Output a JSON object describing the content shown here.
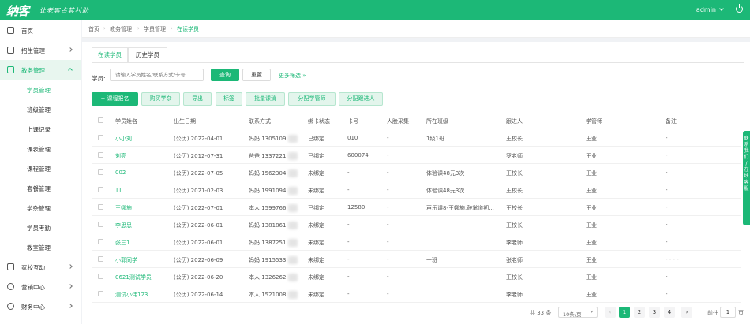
{
  "header": {
    "logo": "纳客",
    "slogan": "让老客占其村助",
    "user": "admin"
  },
  "colors": {
    "primary": "#1cb877"
  },
  "sidebar": {
    "items": [
      {
        "label": "首页",
        "icon": "home-icon"
      },
      {
        "label": "招生管理",
        "icon": "recruit-icon"
      },
      {
        "label": "教务管理",
        "icon": "book-icon"
      },
      {
        "label": "家校互动",
        "icon": "chat-icon"
      },
      {
        "label": "营销中心",
        "icon": "target-icon"
      },
      {
        "label": "财务中心",
        "icon": "money-icon"
      }
    ],
    "subitems": [
      "学员管理",
      "班级管理",
      "上课记录",
      "课表管理",
      "课程管理",
      "套餐管理",
      "学杂管理",
      "学员考勤",
      "教室管理"
    ]
  },
  "breadcrumb": [
    "首页",
    "教务管理",
    "学员管理",
    "在读学员"
  ],
  "tabs": [
    "在读学员",
    "历史学员"
  ],
  "filter": {
    "label": "学员:",
    "placeholder": "请输入学员姓名/联系方式/卡号",
    "search_btn": "查询",
    "reset_btn": "重置",
    "more": "更多筛选 »"
  },
  "actions": [
    "+ 课程报名",
    "购买学杂",
    "导出",
    "标签",
    "批量课消",
    "分配学管师",
    "分配跟进人"
  ],
  "table": {
    "headers": [
      "学员姓名",
      "出生日期",
      "联系方式",
      "绑卡状态",
      "卡号",
      "人脸采集",
      "所在班级",
      "跟进人",
      "学管师",
      "备注"
    ],
    "rows": [
      [
        "小小刘",
        "(公历) 2022-04-01",
        "妈妈 1305109",
        "已绑定",
        "010",
        "-",
        "1级1班",
        "王校长",
        "王业",
        "-"
      ],
      [
        "刘亮",
        "(公历) 2012-07-31",
        "爸爸 1337221",
        "已绑定",
        "600074",
        "-",
        "",
        "罗老师",
        "王业",
        "-"
      ],
      [
        "002",
        "(公历) 2022-07-05",
        "妈妈 1562304",
        "未绑定",
        "-",
        "-",
        "体验课48元3次",
        "王校长",
        "王业",
        "-"
      ],
      [
        "TT",
        "(公历) 2021-02-03",
        "妈妈 1991094",
        "未绑定",
        "-",
        "-",
        "体验课48元3次",
        "王校长",
        "王业",
        "-"
      ],
      [
        "王娜施",
        "(公历) 2022-07-01",
        "本人 1599766",
        "已绑定",
        "12580",
        "-",
        "声乐课8-王娜施,鼓掌道初...",
        "王校长",
        "王业",
        "-"
      ],
      [
        "李思思",
        "(公历) 2022-06-01",
        "妈妈 1381861",
        "未绑定",
        "-",
        "-",
        "",
        "王校长",
        "王业",
        "-"
      ],
      [
        "张三1",
        "(公历) 2022-06-01",
        "妈妈 1387251",
        "未绑定",
        "-",
        "-",
        "",
        "李老师",
        "王业",
        "-"
      ],
      [
        "小郭同学",
        "(公历) 2022-06-09",
        "妈妈 1915533",
        "未绑定",
        "-",
        "-",
        "一班",
        "张老师",
        "王业",
        "- - - -"
      ],
      [
        "0621测试学员",
        "(公历) 2022-06-20",
        "本人 1326262",
        "未绑定",
        "-",
        "-",
        "",
        "王校长",
        "王业",
        "-"
      ],
      [
        "测试小伟123",
        "(公历) 2022-06-14",
        "本人 1521008",
        "未绑定",
        "-",
        "-",
        "",
        "李老师",
        "王业",
        "-"
      ]
    ]
  },
  "pagination": {
    "total": "共 33 条",
    "page_size": "10条/页",
    "pages": [
      "1",
      "2",
      "3",
      "4"
    ],
    "goto_label": "前往",
    "goto_value": "1",
    "goto_suffix": "页"
  },
  "float_tab": "联系我们 / 在线客服"
}
